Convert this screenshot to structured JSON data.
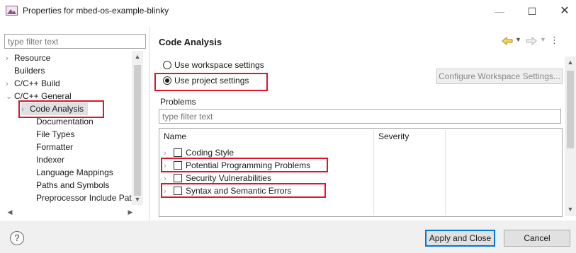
{
  "window": {
    "title": "Properties for mbed-os-example-blinky",
    "minimize_glyph": "—",
    "maximize_glyph": "☐",
    "close_glyph": "✕"
  },
  "left_panel": {
    "filter_placeholder": "type filter text",
    "tree": [
      {
        "label": "Resource",
        "expandable": true,
        "expanded": false,
        "indent": 0
      },
      {
        "label": "Builders",
        "expandable": false,
        "indent": 0
      },
      {
        "label": "C/C++ Build",
        "expandable": true,
        "expanded": false,
        "indent": 0
      },
      {
        "label": "C/C++ General",
        "expandable": true,
        "expanded": true,
        "indent": 0
      },
      {
        "label": "Code Analysis",
        "expandable": true,
        "expanded": false,
        "indent": 1,
        "selected": true
      },
      {
        "label": "Documentation",
        "expandable": false,
        "indent": 1
      },
      {
        "label": "File Types",
        "expandable": false,
        "indent": 1
      },
      {
        "label": "Formatter",
        "expandable": false,
        "indent": 1
      },
      {
        "label": "Indexer",
        "expandable": false,
        "indent": 1
      },
      {
        "label": "Language Mappings",
        "expandable": false,
        "indent": 1
      },
      {
        "label": "Paths and Symbols",
        "expandable": false,
        "indent": 1
      },
      {
        "label": "Preprocessor Include Pat",
        "expandable": false,
        "indent": 1
      }
    ]
  },
  "main": {
    "title": "Code Analysis",
    "use_workspace_settings": "Use workspace settings",
    "use_project_settings": "Use project settings",
    "selected_option": "project",
    "configure_button": "Configure Workspace Settings...",
    "problems_label": "Problems",
    "problems_filter_placeholder": "type filter text",
    "table": {
      "columns": [
        "Name",
        "Severity"
      ],
      "rows": [
        {
          "label": "Coding Style",
          "checked": false
        },
        {
          "label": "Potential Programming Problems",
          "checked": false
        },
        {
          "label": "Security Vulnerabilities",
          "checked": false
        },
        {
          "label": "Syntax and Semantic Errors",
          "checked": false
        }
      ]
    }
  },
  "footer": {
    "help_glyph": "?",
    "apply_close": "Apply and Close",
    "cancel": "Cancel"
  },
  "colors": {
    "highlight": "#e0142a",
    "accent": "#0078d7",
    "nav_arrow": "#d9a400"
  },
  "icons": [
    "app-icon",
    "back-arrow-icon",
    "forward-arrow-icon",
    "view-menu-icon",
    "help-icon"
  ]
}
